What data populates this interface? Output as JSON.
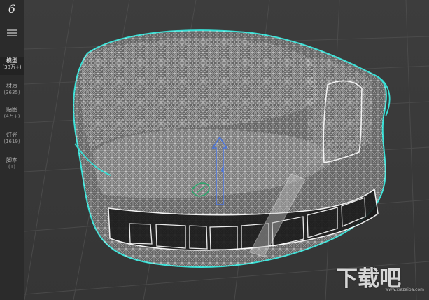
{
  "app": {
    "logo_text": "6",
    "accent_color": "#35c5b0",
    "sidebar_color": "#2b2b2b",
    "viewport_color": "#3a3a3a"
  },
  "sidebar": {
    "menu_icon": "hamburger-menu-icon",
    "items": [
      {
        "label": "模型",
        "count": "(38万+)",
        "active": true
      },
      {
        "label": "材质",
        "count": "(3635)",
        "active": false
      },
      {
        "label": "贴图",
        "count": "(4万+)",
        "active": false
      },
      {
        "label": "灯光",
        "count": "(1619)",
        "active": false
      },
      {
        "label": "脚本",
        "count": "(1)",
        "active": false
      }
    ]
  },
  "viewport": {
    "object": "wireframe sofa model",
    "gizmo": "move gizmo"
  },
  "watermark": {
    "text": "下载吧",
    "subtext": "www.xiazaiba.com"
  }
}
